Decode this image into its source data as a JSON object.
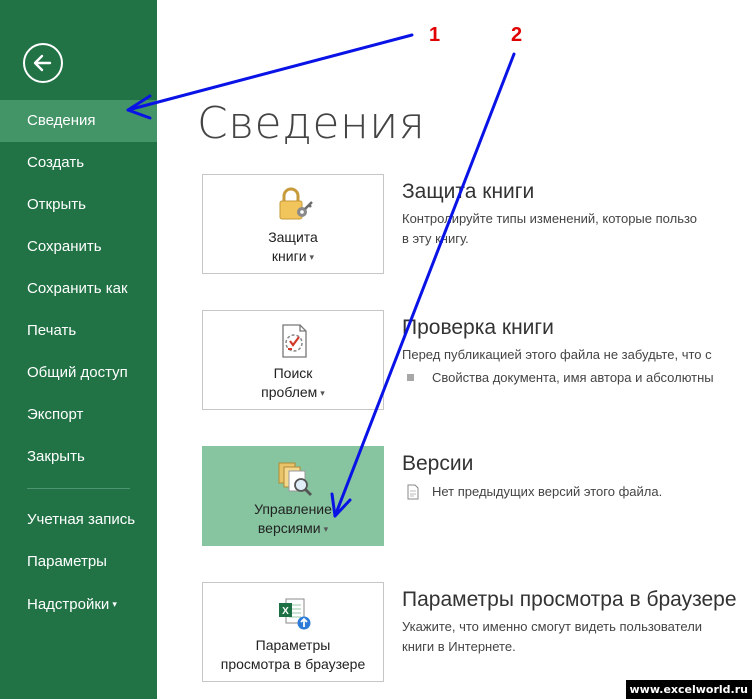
{
  "sidebar": {
    "back_label": "back",
    "items": [
      {
        "label": "Сведения",
        "active": true
      },
      {
        "label": "Создать"
      },
      {
        "label": "Открыть"
      },
      {
        "label": "Сохранить"
      },
      {
        "label": "Сохранить как"
      },
      {
        "label": "Печать"
      },
      {
        "label": "Общий доступ"
      },
      {
        "label": "Экспорт"
      },
      {
        "label": "Закрыть"
      }
    ],
    "bottom_items": [
      {
        "label": "Учетная запись"
      },
      {
        "label": "Параметры"
      },
      {
        "label": "Надстройки"
      }
    ],
    "bg_color": "#217346",
    "active_color": "#439467"
  },
  "main": {
    "title": "Сведения",
    "sections": [
      {
        "button_line1": "Защита",
        "button_line2": "книги",
        "icon": "lock-key-icon",
        "heading": "Защита книги",
        "text_line1": "Контролируйте типы изменений, которые пользо",
        "text_line2": "в эту книгу."
      },
      {
        "button_line1": "Поиск",
        "button_line2": "проблем",
        "icon": "inspect-document-icon",
        "heading": "Проверка книги",
        "text_line1": "Перед публикацией этого файла не забудьте, что с",
        "bullet_text": "Свойства документа, имя автора и абсолютны"
      },
      {
        "button_line1": "Управление",
        "button_line2": "версиями",
        "icon": "manage-versions-icon",
        "heading": "Версии",
        "info_text": "Нет предыдущих версий этого файла."
      },
      {
        "button_line1": "Параметры",
        "button_line2": "просмотра в браузере",
        "icon": "browser-view-options-icon",
        "heading": "Параметры просмотра в браузере",
        "text_line1": "Укажите, что именно смогут видеть пользователи",
        "text_line2": "книги в Интернете."
      }
    ]
  },
  "annotations": {
    "label1": "1",
    "label2": "2",
    "watermark": "www.excelworld.ru",
    "arrow_color": "#0a13e6",
    "number_color": "#e10000"
  }
}
